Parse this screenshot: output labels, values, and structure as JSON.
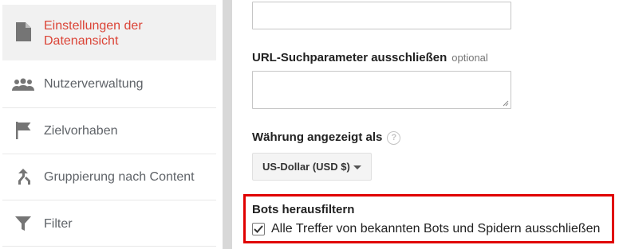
{
  "sidebar": {
    "items": [
      {
        "label_line1": "Einstellungen der",
        "label_line2": "Datenansicht",
        "icon": "document-icon",
        "active": true
      },
      {
        "label": "Nutzerverwaltung",
        "icon": "people-icon"
      },
      {
        "label": "Zielvorhaben",
        "icon": "flag-icon"
      },
      {
        "label": "Gruppierung nach Content",
        "icon": "merge-icon"
      },
      {
        "label": "Filter",
        "icon": "filter-icon"
      }
    ],
    "active_color": "#db4437"
  },
  "form": {
    "top_input_value": "",
    "url_params": {
      "label": "URL-Suchparameter ausschließen",
      "optional": "optional",
      "value": ""
    },
    "currency": {
      "label": "Währung angezeigt als",
      "help": "?",
      "selected": "US-Dollar (USD $)"
    },
    "bots": {
      "label": "Bots herausfiltern",
      "checkbox_label": "Alle Treffer von bekannten Bots und Spidern ausschließen",
      "checked": true
    }
  }
}
